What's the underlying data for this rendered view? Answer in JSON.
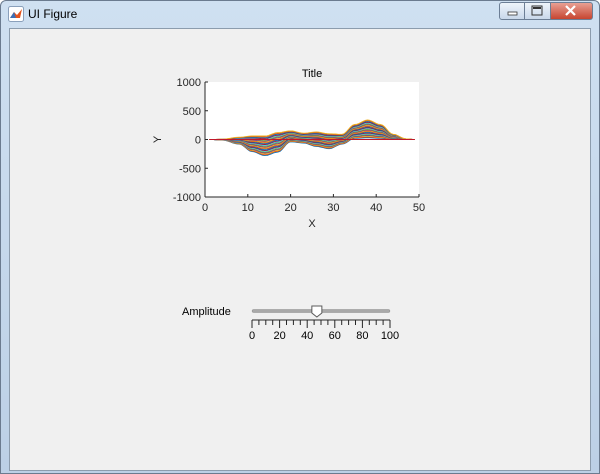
{
  "window": {
    "title": "UI Figure"
  },
  "chart_data": {
    "type": "line",
    "title": "Title",
    "xlabel": "X",
    "ylabel": "Y",
    "xlim": [
      0,
      50
    ],
    "ylim": [
      -1000,
      1000
    ],
    "xticks": [
      "0",
      "10",
      "20",
      "30",
      "40",
      "50"
    ],
    "yticks": [
      "1000",
      "500",
      "0",
      "-500",
      "-1000"
    ],
    "x_range": [
      1,
      49
    ],
    "series_count": 24,
    "colors": [
      "#0072bd",
      "#d95319",
      "#edb120",
      "#7e2f8e",
      "#77ac30",
      "#4dbeee",
      "#a2142f"
    ],
    "envelope": {
      "x": [
        1,
        4,
        8,
        11,
        14,
        17,
        20,
        23,
        26,
        29,
        32,
        35,
        38,
        41,
        44,
        47,
        49
      ],
      "upper": [
        0,
        5,
        40,
        60,
        60,
        120,
        150,
        110,
        130,
        100,
        90,
        260,
        340,
        260,
        90,
        10,
        0
      ],
      "lower": [
        0,
        -10,
        -80,
        -210,
        -280,
        -220,
        -40,
        -60,
        -120,
        -160,
        -80,
        20,
        30,
        20,
        0,
        0,
        0
      ]
    }
  },
  "slider": {
    "label": "Amplitude",
    "min": 0,
    "max": 100,
    "value": 47,
    "major_ticks": [
      "0",
      "20",
      "40",
      "60",
      "80",
      "100"
    ]
  }
}
